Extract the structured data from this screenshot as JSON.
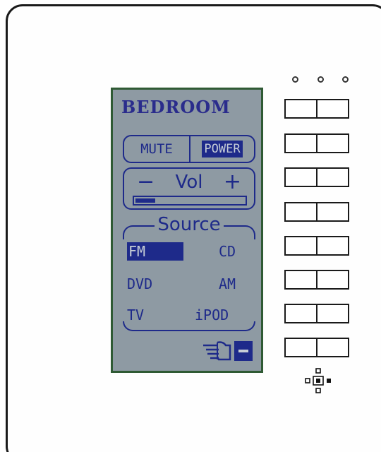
{
  "device": {
    "room_title": "BEDROOM",
    "buttons": {
      "mute_label": "MUTE",
      "power_label": "POWER"
    },
    "volume": {
      "minus_label": "−",
      "label": "Vol",
      "plus_label": "+",
      "level_fraction": 0.18
    },
    "source": {
      "title": "Source",
      "options": [
        {
          "label": "FM",
          "selected": true
        },
        {
          "label": "CD",
          "selected": false
        },
        {
          "label": "DVD",
          "selected": false
        },
        {
          "label": "AM",
          "selected": false
        },
        {
          "label": "TV",
          "selected": false
        },
        {
          "label": "iPOD",
          "selected": false
        }
      ]
    },
    "footer_icons": [
      "pointing-hand-icon",
      "minus-icon"
    ]
  },
  "keypad": {
    "led_count": 3,
    "rows": 8,
    "icons": [
      "led-indicator",
      "ir-sensor-icon"
    ]
  },
  "colors": {
    "lcd_background": "#8e9aa3",
    "lcd_border": "#2f5a34",
    "lcd_ink": "#1e2a8a",
    "title_ink": "#2a2c8c"
  }
}
